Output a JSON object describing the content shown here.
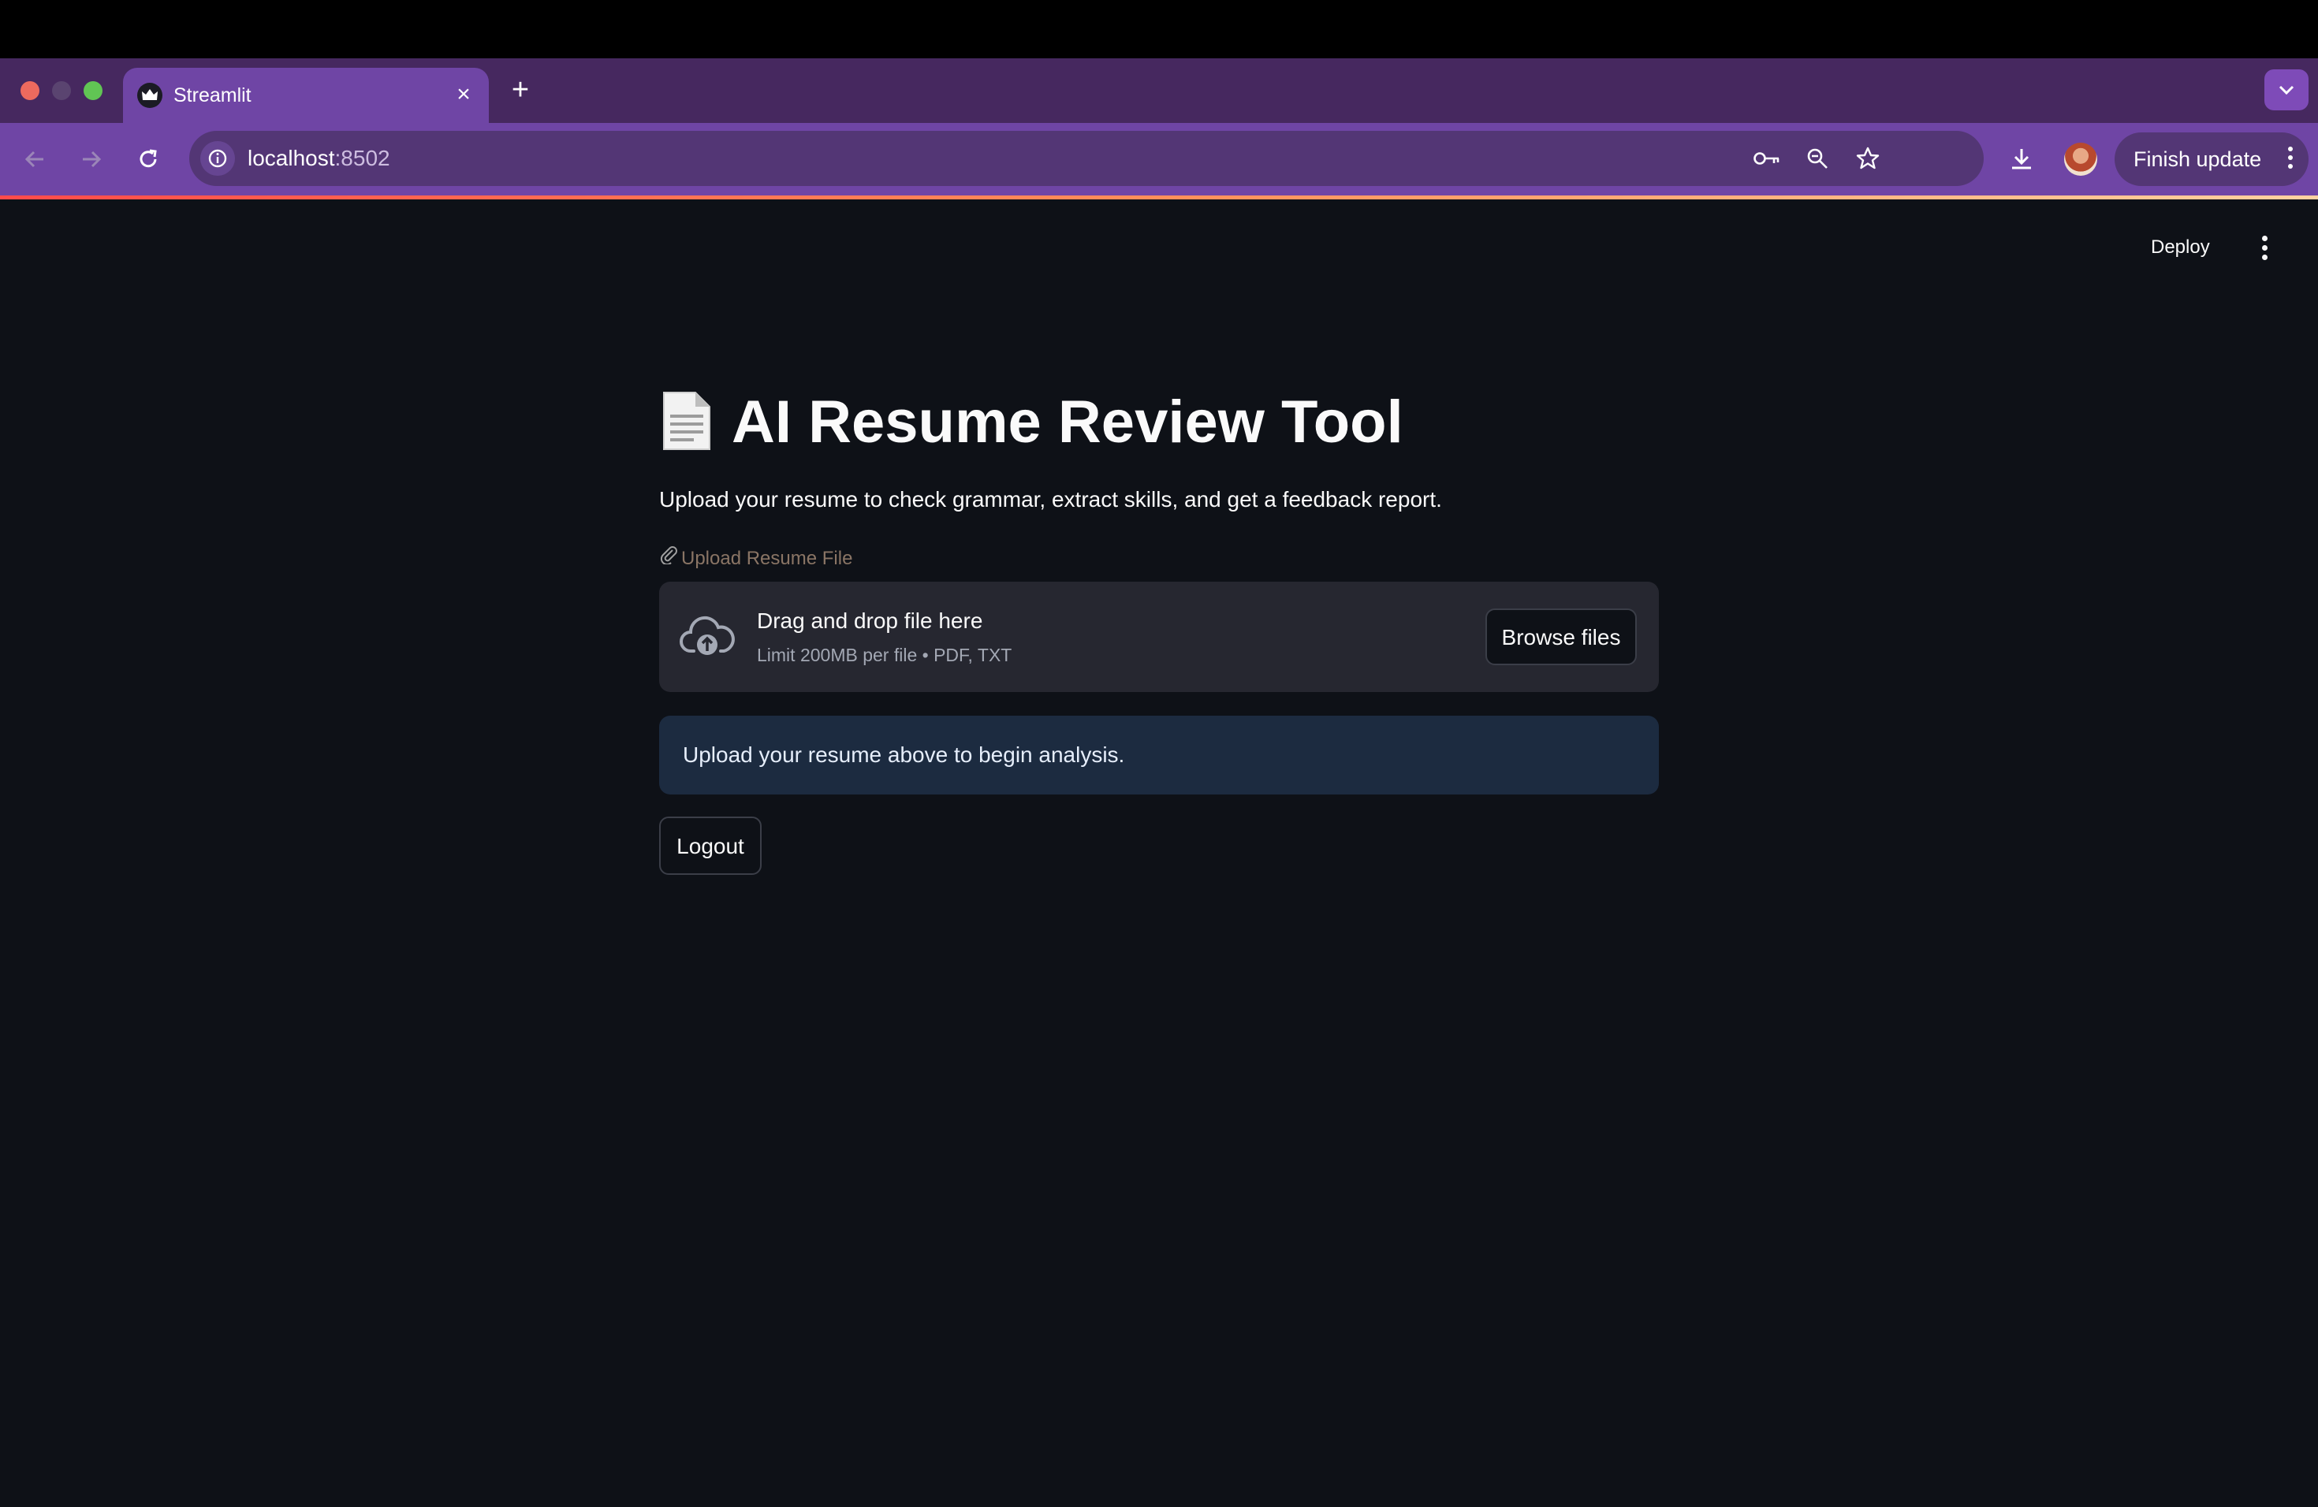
{
  "browser": {
    "tab_title": "Streamlit",
    "url_host": "localhost",
    "url_port": ":8502",
    "finish_update_label": "Finish update",
    "accent_colors": [
      "#ff4b4b",
      "#ff8f5a",
      "#ffd1a1"
    ]
  },
  "header": {
    "deploy_label": "Deploy"
  },
  "main": {
    "title": "AI Resume Review Tool",
    "title_icon": "page-facing-up-emoji",
    "subtitle": "Upload your resume to check grammar, extract skills, and get a feedback report.",
    "uploader": {
      "label": "Upload Resume File",
      "label_icon": "paperclip-icon",
      "drop_title": "Drag and drop file here",
      "limit_text": "Limit 200MB per file • PDF, TXT",
      "browse_label": "Browse files"
    },
    "info_message": "Upload your resume above to begin analysis.",
    "logout_label": "Logout"
  }
}
